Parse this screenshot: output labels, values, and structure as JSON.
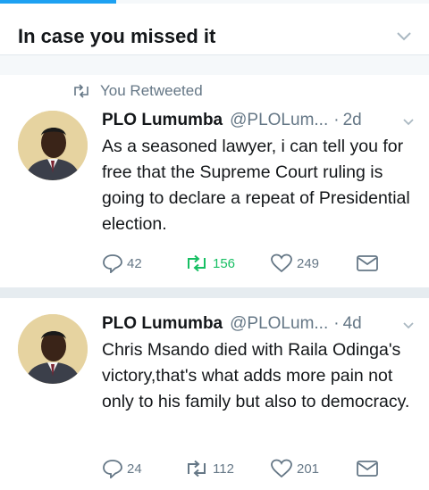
{
  "section": {
    "title": "In case you missed it"
  },
  "tweets": [
    {
      "context": "You Retweeted",
      "name": "PLO Lumumba",
      "handle": "@PLOLum...",
      "time": "2d",
      "text": "As a seasoned lawyer, i can tell you for free that the Supreme Court ruling is going to declare a repeat of Presidential election.",
      "replies": "42",
      "retweets": "156",
      "likes": "249"
    },
    {
      "name": "PLO Lumumba",
      "handle": "@PLOLum...",
      "time": "4d",
      "text": "Chris Msando died with Raila Odinga's victory,that's what adds more pain not only to his family but also to democracy.",
      "replies": "24",
      "retweets": "112",
      "likes": "201"
    }
  ],
  "icons": {
    "retweet": "retweet-icon",
    "reply": "reply-icon",
    "like": "heart-icon",
    "dm": "envelope-icon",
    "menu": "chevron-down-icon"
  },
  "colors": {
    "accent": "#1da1f2",
    "retweet_active": "#17bf63",
    "muted": "#657786"
  }
}
